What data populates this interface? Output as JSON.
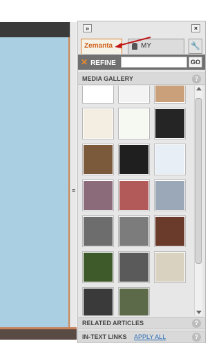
{
  "panel": {
    "collapse_label": "»",
    "close_label": "×",
    "tabs": [
      {
        "label": "Zemanta"
      },
      {
        "label": "MY SOURCES"
      }
    ],
    "wrench_label": "🔧",
    "refine_label": "REFINE",
    "refine_placeholder": "",
    "go_label": "GO"
  },
  "media_gallery": {
    "title": "MEDIA GALLERY",
    "help": "?"
  },
  "related_articles": {
    "title": "RELATED ARTICLES",
    "help": "?"
  },
  "in_text_links": {
    "title": "IN-TEXT LINKS",
    "apply_label": "APPLY ALL",
    "help": "?"
  },
  "gallery_thumbs": [
    {
      "name": "thumb-partial-1",
      "color": "#ffffff"
    },
    {
      "name": "thumb-partial-2",
      "color": "#f3f3f3"
    },
    {
      "name": "thumb-partial-3",
      "color": "#c9a07a"
    },
    {
      "name": "thumb-document",
      "color": "#f4ede1"
    },
    {
      "name": "thumb-sketch",
      "color": "#f6f8f2"
    },
    {
      "name": "thumb-dark",
      "color": "#252525"
    },
    {
      "name": "thumb-portrait",
      "color": "#7a5a3a"
    },
    {
      "name": "thumb-lv2",
      "color": "#1f1f1f"
    },
    {
      "name": "thumb-robot",
      "color": "#e8eef6"
    },
    {
      "name": "thumb-colorful-1",
      "color": "#8b6a7a"
    },
    {
      "name": "thumb-colorful-2",
      "color": "#b25a5a"
    },
    {
      "name": "thumb-colorful-3",
      "color": "#9aa8b8"
    },
    {
      "name": "thumb-bw-face",
      "color": "#6d6d6d"
    },
    {
      "name": "thumb-bw-building",
      "color": "#7c7c7c"
    },
    {
      "name": "thumb-interior",
      "color": "#6a3a2a"
    },
    {
      "name": "thumb-green",
      "color": "#3f5a2a"
    },
    {
      "name": "thumb-street",
      "color": "#5a5a5a"
    },
    {
      "name": "thumb-beige",
      "color": "#d9d2c0"
    },
    {
      "name": "thumb-bw-dark",
      "color": "#3a3a3a"
    },
    {
      "name": "thumb-animal",
      "color": "#5c6a4a"
    }
  ]
}
